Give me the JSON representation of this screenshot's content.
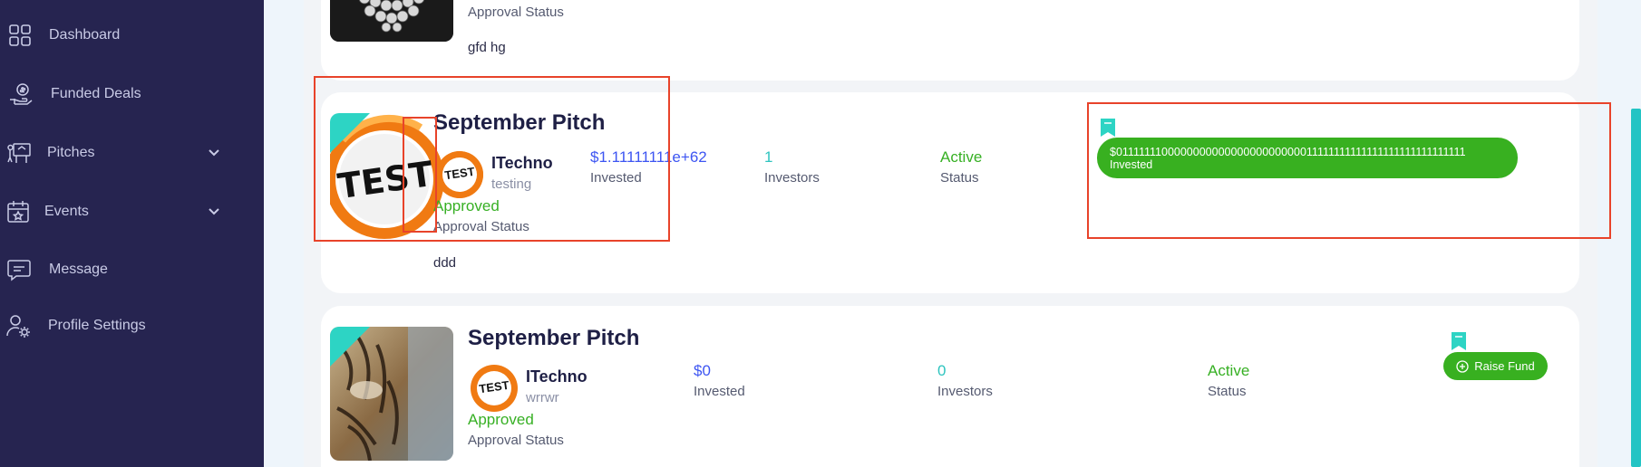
{
  "sidebar": {
    "items": [
      {
        "label": "Dashboard",
        "icon": "grid-icon"
      },
      {
        "label": "Funded Deals",
        "icon": "money-hand-icon"
      },
      {
        "label": "Pitches",
        "icon": "presentation-icon"
      },
      {
        "label": "Events",
        "icon": "calendar-star-icon"
      },
      {
        "label": "Message",
        "icon": "chat-bubble-icon"
      },
      {
        "label": "Profile Settings",
        "icon": "user-gear-icon"
      }
    ]
  },
  "cards": {
    "top": {
      "approval_label": "Approval Status",
      "description": "gfd hg"
    },
    "middle": {
      "title": "September Pitch",
      "thumbnail_text": "TEST",
      "avatar_text": "TEST",
      "company": "ITechno",
      "subtitle": "testing",
      "approval_value": "Approved",
      "approval_label": "Approval Status",
      "invested_value": "$1.11111111e+62",
      "invested_label": "Invested",
      "investors_value": "1",
      "investors_label": "Investors",
      "status_value": "Active",
      "status_label": "Status",
      "description": "ddd",
      "pill_amount": "$011111110000000000000000000000011111111111111111111111111111",
      "pill_label": "Invested"
    },
    "bottom": {
      "title": "September Pitch",
      "avatar_text": "TEST",
      "company": "ITechno",
      "subtitle": "wrrwr",
      "approval_value": "Approved",
      "approval_label": "Approval Status",
      "invested_value": "$0",
      "invested_label": "Invested",
      "investors_value": "0",
      "investors_label": "Investors",
      "status_value": "Active",
      "status_label": "Status",
      "raise_label": "Raise Fund"
    }
  },
  "colors": {
    "sidebar_bg": "#262450",
    "accent_green": "#38b020",
    "accent_teal": "#2dd4c4",
    "value_blue": "#3d55f2",
    "annotation_red": "#e8432a"
  }
}
